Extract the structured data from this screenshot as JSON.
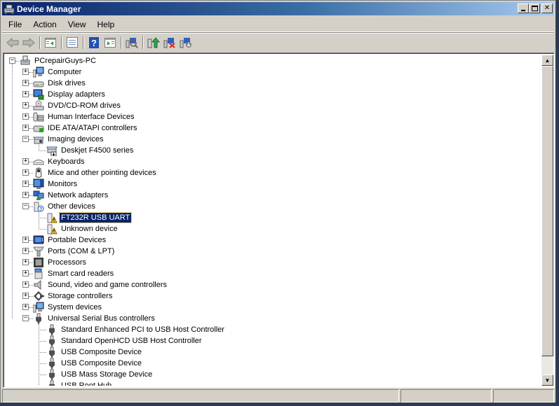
{
  "window": {
    "title": "Device Manager",
    "controls": {
      "minimize": "_",
      "maximize": "□",
      "close": "✕"
    }
  },
  "menu": [
    "File",
    "Action",
    "View",
    "Help"
  ],
  "toolbar": [
    {
      "name": "back-button",
      "icon": "back-arrow-icon",
      "tooltip": "Back"
    },
    {
      "name": "forward-button",
      "icon": "forward-arrow-icon",
      "tooltip": "Forward"
    },
    {
      "sep": true
    },
    {
      "name": "show-hide-console-tree-button",
      "icon": "console-tree-icon"
    },
    {
      "sep": true
    },
    {
      "name": "properties-button",
      "icon": "properties-icon"
    },
    {
      "sep": true
    },
    {
      "name": "help-button",
      "icon": "help-icon"
    },
    {
      "name": "show-hide-action-pane-button",
      "icon": "action-pane-icon"
    },
    {
      "sep": true
    },
    {
      "name": "scan-hardware-changes-button",
      "icon": "scan-hardware-icon"
    },
    {
      "sep": true
    },
    {
      "name": "update-driver-button",
      "icon": "update-driver-icon"
    },
    {
      "name": "uninstall-button",
      "icon": "uninstall-icon"
    },
    {
      "name": "disable-button",
      "icon": "disable-device-icon"
    }
  ],
  "tree": {
    "root": "PCrepairGuys-PC",
    "items": [
      {
        "label": "Computer",
        "icon": "computer-icon",
        "expanded": false
      },
      {
        "label": "Disk drives",
        "icon": "disk-drive-icon",
        "expanded": false
      },
      {
        "label": "Display adapters",
        "icon": "display-adapter-icon",
        "expanded": false
      },
      {
        "label": "DVD/CD-ROM drives",
        "icon": "dvd-drive-icon",
        "expanded": false
      },
      {
        "label": "Human Interface Devices",
        "icon": "hid-icon",
        "expanded": false
      },
      {
        "label": "IDE ATA/ATAPI controllers",
        "icon": "ide-controller-icon",
        "expanded": false
      },
      {
        "label": "Imaging devices",
        "icon": "imaging-device-icon",
        "expanded": true,
        "children": [
          {
            "label": "Deskjet F4500 series",
            "icon": "printer-scanner-icon"
          }
        ]
      },
      {
        "label": "Keyboards",
        "icon": "keyboard-icon",
        "expanded": false
      },
      {
        "label": "Mice and other pointing devices",
        "icon": "mouse-icon",
        "expanded": false
      },
      {
        "label": "Monitors",
        "icon": "monitor-icon",
        "expanded": false
      },
      {
        "label": "Network adapters",
        "icon": "network-adapter-icon",
        "expanded": false
      },
      {
        "label": "Other devices",
        "icon": "unknown-device-icon",
        "expanded": true,
        "children": [
          {
            "label": "FT232R USB UART",
            "icon": "warning-device-icon",
            "selected": true,
            "status": "warning"
          },
          {
            "label": "Unknown device",
            "icon": "warning-device-icon",
            "status": "warning"
          }
        ]
      },
      {
        "label": "Portable Devices",
        "icon": "portable-device-icon",
        "expanded": false
      },
      {
        "label": "Ports (COM & LPT)",
        "icon": "port-icon",
        "expanded": false
      },
      {
        "label": "Processors",
        "icon": "processor-icon",
        "expanded": false
      },
      {
        "label": "Smart card readers",
        "icon": "smart-card-reader-icon",
        "expanded": false
      },
      {
        "label": "Sound, video and game controllers",
        "icon": "speaker-icon",
        "expanded": false
      },
      {
        "label": "Storage controllers",
        "icon": "storage-controller-icon",
        "expanded": false
      },
      {
        "label": "System devices",
        "icon": "system-device-icon",
        "expanded": false
      },
      {
        "label": "Universal Serial Bus controllers",
        "icon": "usb-icon",
        "expanded": true,
        "children": [
          {
            "label": "Standard Enhanced PCI to USB Host Controller",
            "icon": "usb-icon"
          },
          {
            "label": "Standard OpenHCD USB Host Controller",
            "icon": "usb-icon"
          },
          {
            "label": "USB Composite Device",
            "icon": "usb-icon"
          },
          {
            "label": "USB Composite Device",
            "icon": "usb-icon"
          },
          {
            "label": "USB Mass Storage Device",
            "icon": "usb-icon"
          },
          {
            "label": "USB Root Hub",
            "icon": "usb-icon"
          }
        ]
      }
    ]
  },
  "statusbar": [
    "",
    "",
    ""
  ],
  "colors": {
    "title_gradient_start": "#0a246a",
    "title_gradient_end": "#a6caf0",
    "selection": "#0a246a",
    "chrome": "#d4d0c8"
  }
}
